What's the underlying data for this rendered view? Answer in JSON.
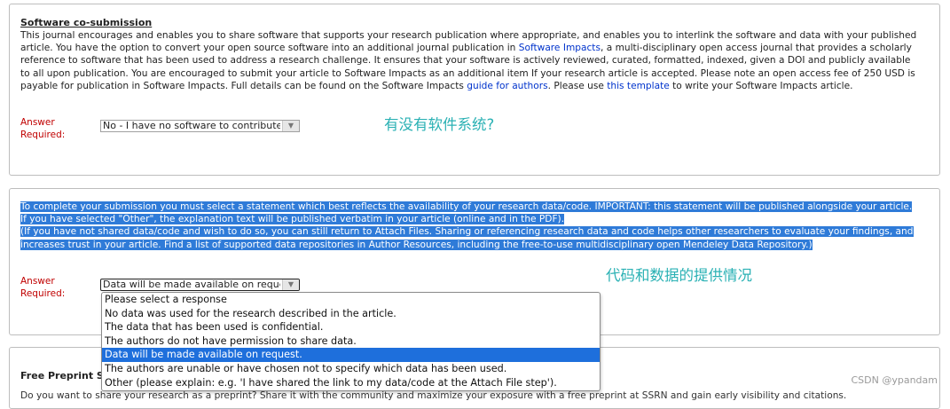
{
  "software": {
    "title": "Software co-submission",
    "lines": [
      [
        "This journal encourages and enables you to share software that supports your research publication where appropriate, and enables you to interlink the software and data with your published"
      ],
      [
        "article. You have the option to convert your open source software into an additional journal publication in ",
        {
          "link": "Software Impacts"
        },
        ", a multi-disciplinary open access journal that provides a scholarly"
      ],
      [
        "reference to software that has been used to address a research challenge. It ensures that your software is actively reviewed, curated, formatted, indexed, given a DOI and publicly available"
      ],
      [
        "to all upon publication. You are encouraged to submit your article to Software Impacts as an additional item If your research article is accepted. Please note an open access fee of 250 USD is"
      ],
      [
        "payable for publication in Software Impacts. Full details can be found on the Software Impacts ",
        {
          "link": "guide for authors"
        },
        ". Please use ",
        {
          "link": "this template"
        },
        " to write your Software Impacts article."
      ]
    ],
    "answer_label_1": "Answer",
    "answer_label_2": "Required:",
    "select_value": "No - I have no software to contribute",
    "annotation": "有没有软件系统?"
  },
  "data_statement": {
    "lines": [
      "To complete your submission you must select a statement which best reflects the availability of your research data/code. IMPORTANT: this statement will be published alongside your article.",
      "If you have selected \"Other\", the explanation text will be published verbatim in your article (online and in the PDF).",
      "(If you have not shared data/code and wish to do so, you can still return to Attach Files. Sharing or referencing research data and code helps other researchers to evaluate your findings, and",
      "increases trust in your article. Find a list of supported data repositories in Author Resources, including the free-to-use multidisciplinary open Mendeley Data Repository.)"
    ],
    "answer_label_1": "Answer",
    "answer_label_2": "Required:",
    "select_value": "Data will be made available on request.",
    "annotation": "代码和数据的提供情况",
    "options": [
      "Please select a response",
      "No data was used for the research described in the article.",
      "The data that has been used is confidential.",
      "The authors do not have permission to share data.",
      "Data will be made available on request.",
      "The authors are unable or have chosen not to specify which data has been used.",
      "Other (please explain: e.g. 'I have shared the link to my data/code at the Attach File step')."
    ],
    "selected_index": 4
  },
  "preprint": {
    "title": "Free Preprint S",
    "text_fragment": "Do you want to share your research as a preprint? Share it with the community and maximize your exposure with a free preprint at SSRN and gain early visibility and citations."
  },
  "watermark": "CSDN @ypandam"
}
